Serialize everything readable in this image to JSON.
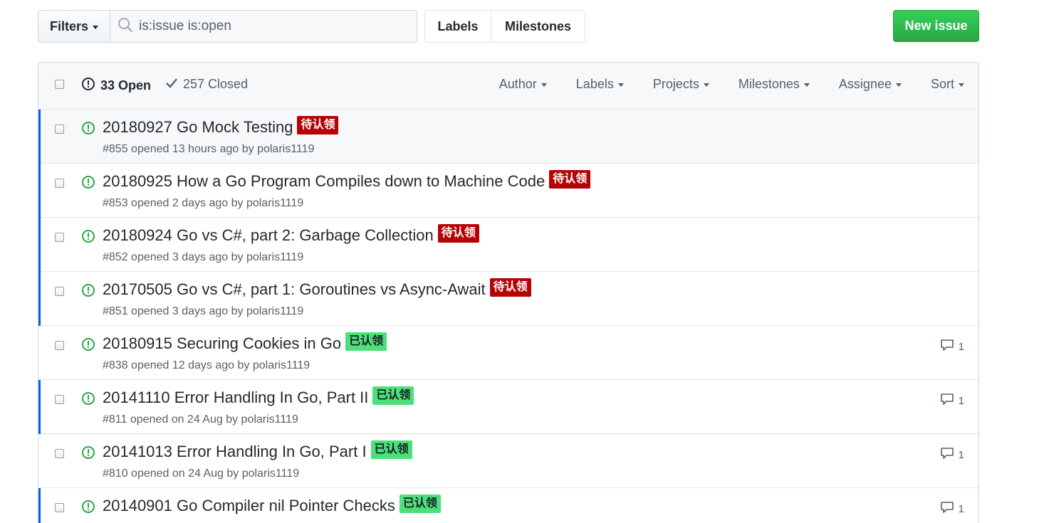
{
  "toolbar": {
    "filters_label": "Filters",
    "search_value": "is:issue is:open",
    "labels_label": "Labels",
    "milestones_label": "Milestones",
    "new_issue_label": "New issue"
  },
  "header": {
    "open_count": "33 Open",
    "closed_count": "257 Closed",
    "filters": [
      "Author",
      "Labels",
      "Projects",
      "Milestones",
      "Assignee",
      "Sort"
    ]
  },
  "colors": {
    "open_icon": "#28a745",
    "label_pending": "#b60205",
    "label_claimed": "#4ce07b",
    "unread_bar": "#0366d6"
  },
  "issues": [
    {
      "title": "20180927 Go Mock Testing",
      "label": "待认领",
      "label_type": "red",
      "meta": "#855 opened 13 hours ago by polaris1119",
      "comments": "",
      "unread": true
    },
    {
      "title": "20180925 How a Go Program Compiles down to Machine Code",
      "label": "待认领",
      "label_type": "red",
      "meta": "#853 opened 2 days ago by polaris1119",
      "comments": "",
      "unread": true
    },
    {
      "title": "20180924 Go vs C#, part 2: Garbage Collection",
      "label": "待认领",
      "label_type": "red",
      "meta": "#852 opened 3 days ago by polaris1119",
      "comments": "",
      "unread": true
    },
    {
      "title": "20170505 Go vs C#, part 1: Goroutines vs Async-Await",
      "label": "待认领",
      "label_type": "red",
      "meta": "#851 opened 3 days ago by polaris1119",
      "comments": "",
      "unread": true
    },
    {
      "title": "20180915 Securing Cookies in Go",
      "label": "已认领",
      "label_type": "green",
      "meta": "#838 opened 12 days ago by polaris1119",
      "comments": "1",
      "unread": false
    },
    {
      "title": "20141110 Error Handling In Go, Part II",
      "label": "已认领",
      "label_type": "green",
      "meta": "#811 opened on 24 Aug by polaris1119",
      "comments": "1",
      "unread": true
    },
    {
      "title": "20141013 Error Handling In Go, Part I",
      "label": "已认领",
      "label_type": "green",
      "meta": "#810 opened on 24 Aug by polaris1119",
      "comments": "1",
      "unread": false
    },
    {
      "title": "20140901 Go Compiler nil Pointer Checks",
      "label": "已认领",
      "label_type": "green",
      "meta": "",
      "comments": "1",
      "unread": true
    }
  ]
}
